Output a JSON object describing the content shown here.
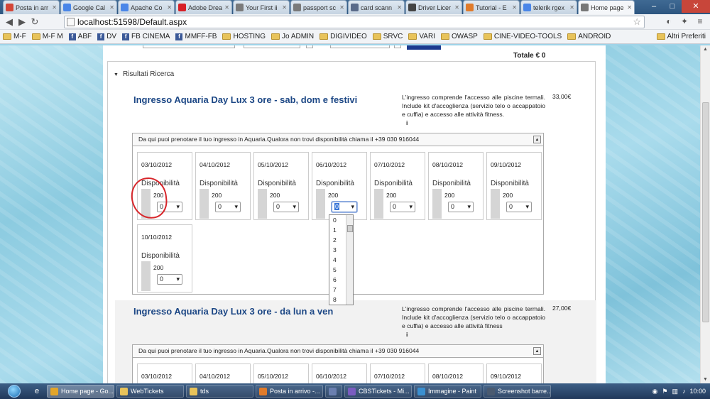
{
  "browser": {
    "tabs": [
      {
        "label": "Posta in arr",
        "icon": "gmail-icon",
        "color": "#d44638"
      },
      {
        "label": "Google Cal",
        "icon": "calendar-icon",
        "color": "#4a86e8"
      },
      {
        "label": "Apache Co",
        "icon": "page-icon",
        "color": "#4a86e8"
      },
      {
        "label": "Adobe Drea",
        "icon": "adobe-icon",
        "color": "#d71f26"
      },
      {
        "label": "Your First ii",
        "icon": "gear-icon",
        "color": "#7a7a7a"
      },
      {
        "label": "passport sc",
        "icon": "gear-icon",
        "color": "#7a7a7a"
      },
      {
        "label": "card scann",
        "icon": "car-icon",
        "color": "#5a6b8a"
      },
      {
        "label": "Driver Licer",
        "icon": "page-icon",
        "color": "#444"
      },
      {
        "label": "Tutorial - E",
        "icon": "globe-icon",
        "color": "#e07b2b"
      },
      {
        "label": "telerik rgex",
        "icon": "search-icon",
        "color": "#4a86e8"
      },
      {
        "label": "Home page",
        "icon": "page-icon",
        "color": "#777"
      }
    ],
    "url": "localhost:51598/Default.aspx",
    "bookmarks": [
      {
        "label": "M-F",
        "type": "folder"
      },
      {
        "label": "M-F M",
        "type": "folder"
      },
      {
        "label": "ABF",
        "type": "fb"
      },
      {
        "label": "DV",
        "type": "fb"
      },
      {
        "label": "FB CINEMA",
        "type": "fb"
      },
      {
        "label": "MMFF-FB",
        "type": "fb"
      },
      {
        "label": "HOSTING",
        "type": "folder"
      },
      {
        "label": "Jo ADMIN",
        "type": "folder"
      },
      {
        "label": "DIGIVIDEO",
        "type": "folder"
      },
      {
        "label": "SRVC",
        "type": "folder"
      },
      {
        "label": "VARI",
        "type": "folder"
      },
      {
        "label": "OWASP",
        "type": "folder"
      },
      {
        "label": "CINE-VIDEO-TOOLS",
        "type": "folder"
      },
      {
        "label": "ANDROID",
        "type": "folder"
      }
    ],
    "other_bookmarks": "Altri Preferiti"
  },
  "page": {
    "totale": "Totale € 0",
    "risultati_label": "Risultati Ricerca",
    "products": [
      {
        "title": "Ingresso Aquaria Day Lux 3 ore - sab, dom e festivi",
        "description": "L'ingresso comprende l'accesso alle piscine termali. Include kit d'accoglienza (servizio telo o accappatoio e cuffia) e accesso alle attività fitness.",
        "info": "i",
        "price": "33,00€",
        "panel_header": "Da qui puoi prenotare il tuo ingresso in Aquaria.Qualora non trovi disponibilità chiama il +39 030 916044",
        "days": [
          {
            "date": "03/10/2012",
            "label": "Disponibilità",
            "qty": "200",
            "selected": "0"
          },
          {
            "date": "04/10/2012",
            "label": "Disponibilità",
            "qty": "200",
            "selected": "0"
          },
          {
            "date": "05/10/2012",
            "label": "Disponibilità",
            "qty": "200",
            "selected": "0"
          },
          {
            "date": "06/10/2012",
            "label": "Disponibilità",
            "qty": "200",
            "selected": "0"
          },
          {
            "date": "07/10/2012",
            "label": "Disponibilità",
            "qty": "200",
            "selected": "0"
          },
          {
            "date": "08/10/2012",
            "label": "Disponibilità",
            "qty": "200",
            "selected": "0"
          },
          {
            "date": "09/10/2012",
            "label": "Disponibilità",
            "qty": "200",
            "selected": "0"
          },
          {
            "date": "10/10/2012",
            "label": "Disponibilità",
            "qty": "200",
            "selected": "0"
          }
        ]
      },
      {
        "title": "Ingresso Aquaria Day Lux 3 ore - da lun a ven",
        "description": "L'ingresso comprende l'accesso alle piscine termali. Include kit d'accoglienza (servizio telo o accappatoio e cuffia) e accesso alle attività fitness",
        "info": "i",
        "price": "27,00€",
        "panel_header": "Da qui puoi prenotare il tuo ingresso in Aquaria.Qualora non trovi disponibilità chiama il +39 030 916044",
        "days": [
          {
            "date": "03/10/2012"
          },
          {
            "date": "04/10/2012"
          },
          {
            "date": "05/10/2012"
          },
          {
            "date": "06/10/2012"
          },
          {
            "date": "07/10/2012"
          },
          {
            "date": "08/10/2012"
          },
          {
            "date": "09/10/2012"
          }
        ]
      }
    ],
    "dropdown_options": [
      "0",
      "1",
      "2",
      "3",
      "4",
      "5",
      "6",
      "7",
      "8"
    ]
  },
  "taskbar": {
    "items": [
      {
        "label": "Home page - Go...",
        "color": "#e2a52a",
        "active": true
      },
      {
        "label": "WebTickets",
        "color": "#e8c35a",
        "active": false
      },
      {
        "label": "tds",
        "color": "#e8c35a",
        "active": false
      },
      {
        "label": "Posta in arrivo -...",
        "color": "#e07b2b",
        "active": false
      },
      {
        "label": "",
        "color": "#6a7fb0",
        "active": false
      },
      {
        "label": "CBSTickets - Mi...",
        "color": "#7a5cc0",
        "active": false
      },
      {
        "label": "Immagine - Paint",
        "color": "#3a8fd0",
        "active": false
      },
      {
        "label": "Screenshot barre...",
        "color": "#4a5a70",
        "active": false
      }
    ],
    "clock": "10:00"
  }
}
